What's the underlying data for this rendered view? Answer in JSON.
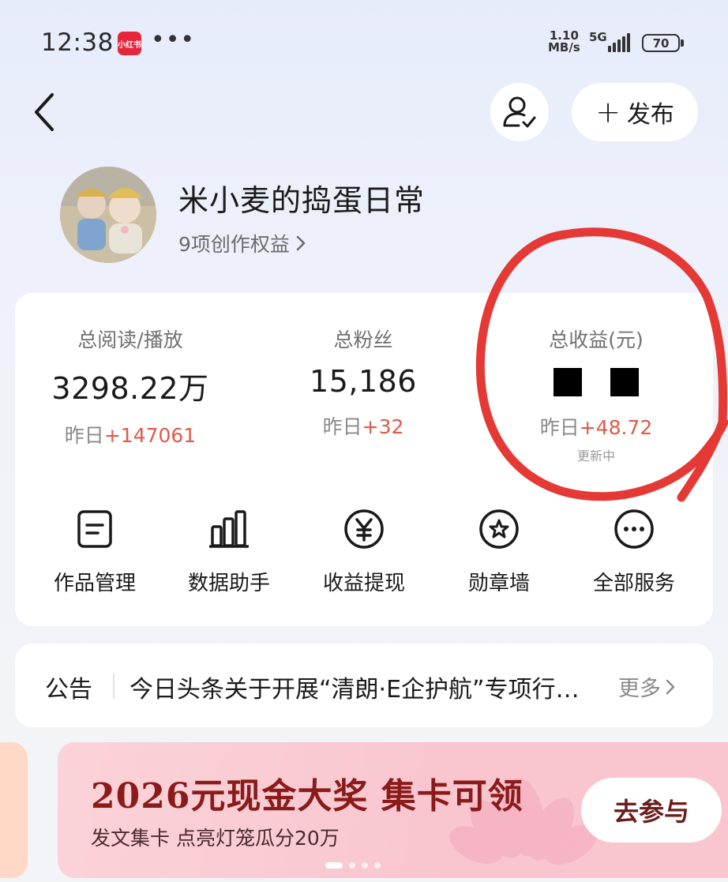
{
  "status_bar": {
    "time": "12:38",
    "app_badge": "小红书",
    "dots": "•••",
    "speed_value": "1.10",
    "speed_unit": "MB/s",
    "network": "5G",
    "battery": "70"
  },
  "header": {
    "back_icon": "chevron-left-icon",
    "user_icon": "user-check-icon",
    "publish_label": "发布"
  },
  "profile": {
    "name": "米小麦的捣蛋日常",
    "benefits": "9项创作权益"
  },
  "stats": [
    {
      "label": "总阅读/播放",
      "value": "3298.22万",
      "delta_prefix": "昨日",
      "delta": "+147061"
    },
    {
      "label": "总粉丝",
      "value": "15,186",
      "delta_prefix": "昨日",
      "delta": "+32"
    },
    {
      "label": "总收益(元)",
      "value": "",
      "delta_prefix": "昨日",
      "delta": "+48.72",
      "note": "更新中"
    }
  ],
  "services": [
    {
      "label": "作品管理",
      "icon": "document-icon"
    },
    {
      "label": "数据助手",
      "icon": "bar-chart-icon"
    },
    {
      "label": "收益提现",
      "icon": "yen-icon"
    },
    {
      "label": "勋章墙",
      "icon": "medal-icon"
    },
    {
      "label": "全部服务",
      "icon": "more-icon"
    }
  ],
  "notice": {
    "title": "公告",
    "text": "今日头条关于开展“清朗·E企护航”专项行动的公告",
    "more": "更多"
  },
  "banner": {
    "title": "2026元现金大奖 集卡可领",
    "subtitle": "发文集卡 点亮灯笼瓜分20万",
    "button": "去参与"
  },
  "colors": {
    "delta_red": "#e0594a",
    "banner_title": "#8a1b1b",
    "annotation": "#e53935"
  }
}
